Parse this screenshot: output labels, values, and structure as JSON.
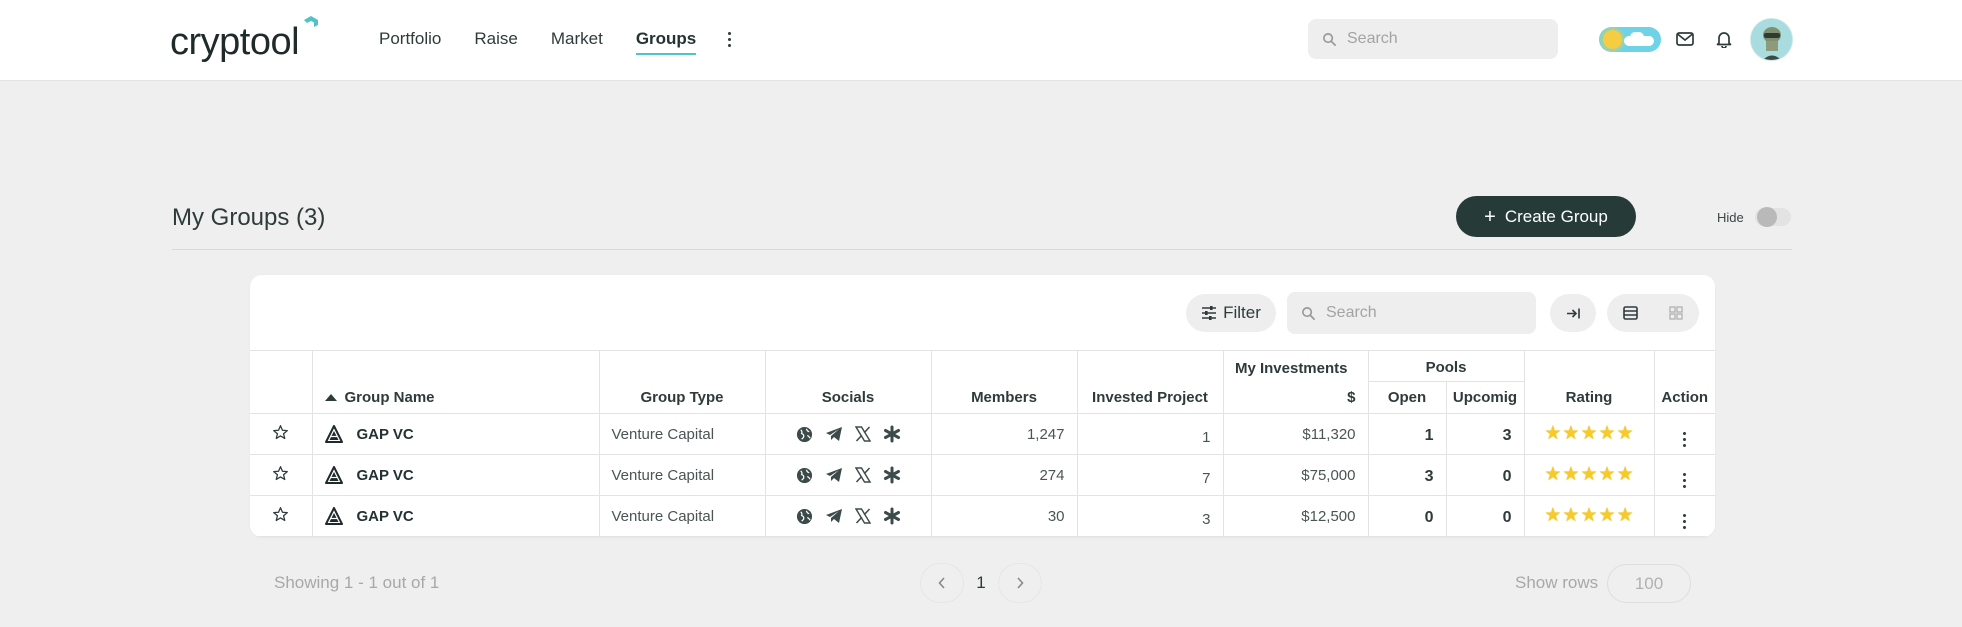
{
  "brand": {
    "name": "cryptool",
    "accent": "#4fc3c8"
  },
  "nav": {
    "items": [
      {
        "label": "Portfolio",
        "active": false
      },
      {
        "label": "Raise",
        "active": false
      },
      {
        "label": "Market",
        "active": false
      },
      {
        "label": "Groups",
        "active": true
      }
    ],
    "more_icon": "more-vertical-icon"
  },
  "header": {
    "search_placeholder": "Search",
    "icons": [
      "theme-toggle-icon",
      "mail-icon",
      "bell-icon",
      "avatar"
    ]
  },
  "page": {
    "title": "My Groups (3)",
    "create_button": "Create Group",
    "hide_label": "Hide",
    "hide_enabled": false
  },
  "toolbar": {
    "filter_label": "Filter",
    "search_placeholder": "Search"
  },
  "table": {
    "columns": {
      "group_name": "Group Name",
      "group_type": "Group Type",
      "socials": "Socials",
      "members": "Members",
      "invested_project": "Invested Project",
      "my_investments": "My Investments",
      "my_investments_unit": "$",
      "pools": "Pools",
      "pools_open": "Open",
      "pools_upcoming": "Upcomig",
      "rating": "Rating",
      "action": "Action"
    },
    "rows": [
      {
        "name": "GAP VC",
        "type": "Venture Capital",
        "members": "1,247",
        "invested": "1",
        "investments": "$11,320",
        "open": "1",
        "upcoming": "3",
        "rating": 5
      },
      {
        "name": "GAP VC",
        "type": "Venture Capital",
        "members": "274",
        "invested": "7",
        "investments": "$75,000",
        "open": "3",
        "upcoming": "0",
        "rating": 5
      },
      {
        "name": "GAP VC",
        "type": "Venture Capital",
        "members": "30",
        "invested": "3",
        "investments": "$12,500",
        "open": "0",
        "upcoming": "0",
        "rating": 5
      }
    ]
  },
  "footer": {
    "showing": "Showing 1 - 1 out of 1",
    "current_page": "1",
    "show_rows_label": "Show rows",
    "rows_per_page": "100"
  },
  "colors": {
    "primary_button": "#263b38",
    "star": "#f6cb29",
    "page_bg": "#efefef"
  }
}
